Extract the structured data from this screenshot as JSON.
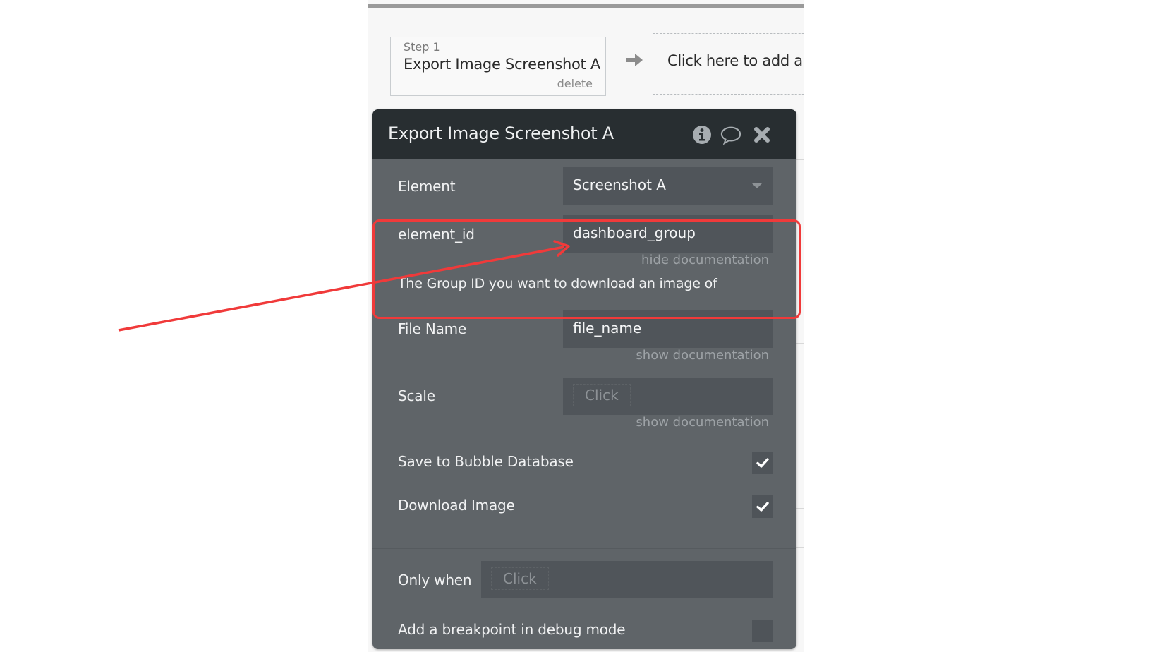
{
  "workflow": {
    "step": {
      "number_label": "Step 1",
      "title": "Export Image Screenshot A",
      "delete_label": "delete"
    },
    "add_action_label": "Click here to add an"
  },
  "panel": {
    "title": "Export Image Screenshot A",
    "icons": [
      "info-icon",
      "comment-icon",
      "close-icon"
    ],
    "fields": {
      "element": {
        "label": "Element",
        "value": "Screenshot A"
      },
      "element_id": {
        "label": "element_id",
        "value": "dashboard_group",
        "doc_toggle": "hide documentation",
        "documentation": "The Group ID you want to download an image of"
      },
      "file_name": {
        "label": "File Name",
        "value": "file_name",
        "doc_toggle": "show documentation"
      },
      "scale": {
        "label": "Scale",
        "placeholder": "Click",
        "doc_toggle": "show documentation"
      },
      "save_to_db": {
        "label": "Save to Bubble Database",
        "checked": true
      },
      "download_image": {
        "label": "Download Image",
        "checked": true
      },
      "only_when": {
        "label": "Only when",
        "placeholder": "Click"
      },
      "breakpoint": {
        "label": "Add a breakpoint in debug mode",
        "checked": false
      }
    }
  },
  "annotation": {
    "color": "#f03a3a",
    "target": "element_id"
  }
}
